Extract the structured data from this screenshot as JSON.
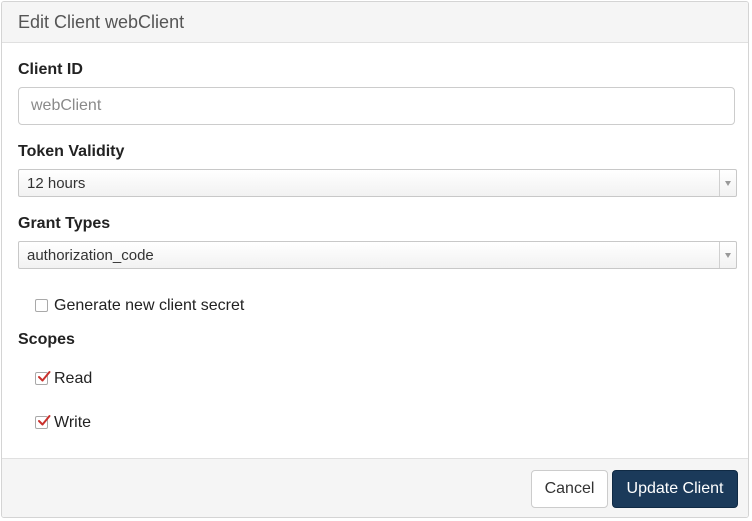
{
  "modal": {
    "title": "Edit Client webClient"
  },
  "fields": {
    "client_id": {
      "label": "Client ID",
      "placeholder": "webClient"
    },
    "token_validity": {
      "label": "Token Validity",
      "selected": "12 hours"
    },
    "grant_types": {
      "label": "Grant Types",
      "selected": "authorization_code"
    }
  },
  "generate_secret": {
    "label": "Generate new client secret",
    "checked": false
  },
  "scopes": {
    "label": "Scopes",
    "items": [
      {
        "label": "Read",
        "checked": true
      },
      {
        "label": "Write",
        "checked": true
      }
    ]
  },
  "footer": {
    "cancel_label": "Cancel",
    "submit_label": "Update Client"
  },
  "colors": {
    "primary_button": "#1b3a5a",
    "check_mark": "#c9302c"
  }
}
